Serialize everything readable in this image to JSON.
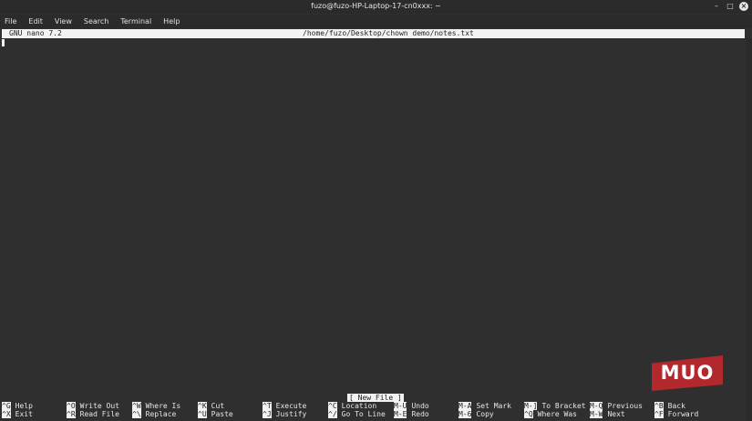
{
  "window": {
    "title": "fuzo@fuzo-HP-Laptop-17-cn0xxx: ~"
  },
  "window_buttons": {
    "minimize": "–",
    "maximize": "□",
    "close": "×"
  },
  "menu": [
    "File",
    "Edit",
    "View",
    "Search",
    "Terminal",
    "Help"
  ],
  "nano": {
    "version": "GNU nano 7.2",
    "filepath": "/home/fuzo/Desktop/chown demo/notes.txt",
    "status": "[ New File ]"
  },
  "shortcuts": [
    [
      {
        "key": "^G",
        "label": "Help"
      },
      {
        "key": "^X",
        "label": "Exit"
      }
    ],
    [
      {
        "key": "^O",
        "label": "Write Out"
      },
      {
        "key": "^R",
        "label": "Read File"
      }
    ],
    [
      {
        "key": "^W",
        "label": "Where Is"
      },
      {
        "key": "^\\",
        "label": "Replace"
      }
    ],
    [
      {
        "key": "^K",
        "label": "Cut"
      },
      {
        "key": "^U",
        "label": "Paste"
      }
    ],
    [
      {
        "key": "^T",
        "label": "Execute"
      },
      {
        "key": "^J",
        "label": "Justify"
      }
    ],
    [
      {
        "key": "^C",
        "label": "Location"
      },
      {
        "key": "^/",
        "label": "Go To Line"
      }
    ],
    [
      {
        "key": "M-U",
        "label": "Undo"
      },
      {
        "key": "M-E",
        "label": "Redo"
      }
    ],
    [
      {
        "key": "M-A",
        "label": "Set Mark"
      },
      {
        "key": "M-6",
        "label": "Copy"
      }
    ],
    [
      {
        "key": "M-]",
        "label": "To Bracket"
      },
      {
        "key": "^Q",
        "label": "Where Was"
      }
    ],
    [
      {
        "key": "M-Q",
        "label": "Previous"
      },
      {
        "key": "M-W",
        "label": "Next"
      }
    ],
    [
      {
        "key": "^B",
        "label": "Back"
      },
      {
        "key": "^F",
        "label": "Forward"
      }
    ]
  ],
  "watermark": {
    "text": "MUO"
  }
}
